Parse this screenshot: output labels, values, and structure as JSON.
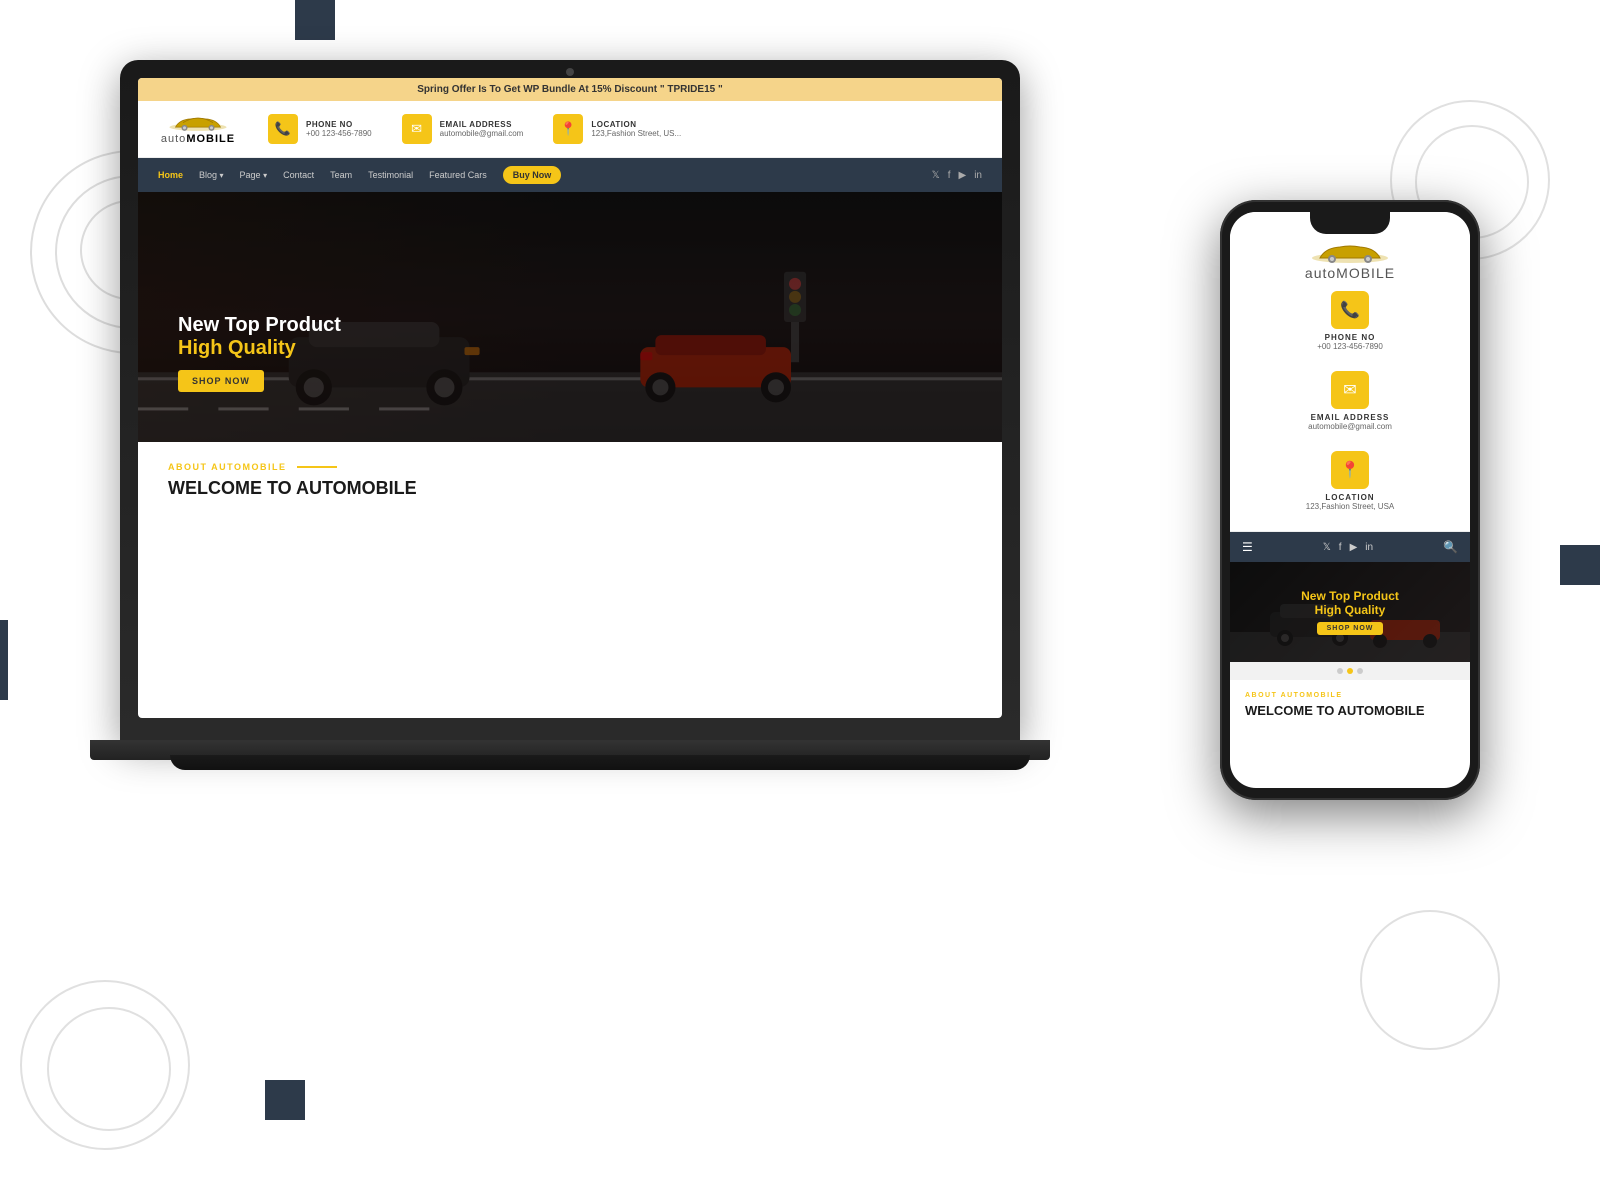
{
  "background": {
    "color": "#ffffff"
  },
  "laptop": {
    "promo_bar": "Spring Offer Is To Get WP Bundle At 15% Discount \" TPRIDE15 \"",
    "logo": {
      "text_light": "auto",
      "text_bold": "MOBILE"
    },
    "contacts": [
      {
        "icon": "📞",
        "label": "PHONE NO",
        "value": "+00 123-456-7890"
      },
      {
        "icon": "✉",
        "label": "EMAIL ADDRESS",
        "value": "automobile@gmail.com"
      },
      {
        "icon": "📍",
        "label": "LOCATION",
        "value": "123,Fashion Street, US..."
      }
    ],
    "nav": {
      "items": [
        {
          "label": "Home",
          "active": true
        },
        {
          "label": "Blog",
          "dropdown": true
        },
        {
          "label": "Page",
          "dropdown": true
        },
        {
          "label": "Contact"
        },
        {
          "label": "Team"
        },
        {
          "label": "Testimonial"
        },
        {
          "label": "Featured Cars"
        }
      ],
      "buy_btn": "Buy Now",
      "social": [
        "𝕏",
        "f",
        "▶",
        "in"
      ]
    },
    "hero": {
      "title_line1": "New Top Product",
      "title_line2_start": "High ",
      "title_line2_highlight": "Quality",
      "shop_btn": "SHOP NOW"
    },
    "about": {
      "label": "ABOUT AUTOMOBILE",
      "title": "WELCOME TO AUTOMOBILE"
    }
  },
  "phone": {
    "logo": {
      "text_light": "auto",
      "text_bold": "MOBILE"
    },
    "contacts": [
      {
        "icon": "📞",
        "label": "PHONE NO",
        "value": "+00 123-456-7890"
      },
      {
        "icon": "✉",
        "label": "EMAIL ADDRESS",
        "value": "automobile@gmail.com"
      },
      {
        "icon": "📍",
        "label": "LOCATION",
        "value": "123,Fashion Street, USA"
      }
    ],
    "hero": {
      "title_line1": "New Top Product",
      "title_line2_start": "High ",
      "title_line2_highlight": "Quality",
      "shop_btn": "SHOP NOW"
    },
    "dots": [
      "inactive",
      "active",
      "inactive"
    ],
    "about": {
      "label": "ABOUT AUTOMOBILE",
      "title": "WELCOME TO AUTOMOBILE"
    }
  }
}
